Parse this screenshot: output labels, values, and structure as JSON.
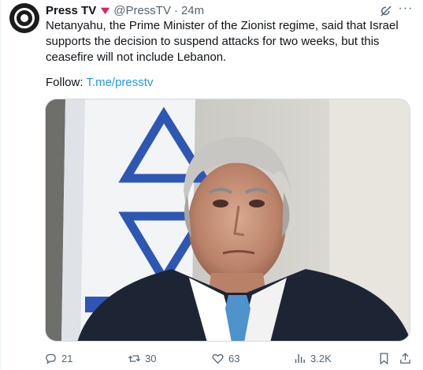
{
  "tweet": {
    "author_name": "Press TV",
    "handle": "@PressTV",
    "separator": "·",
    "time": "24m",
    "text": "Netanyahu, the Prime Minister of the Zionist regime, said that Israel supports the decision to suspend attacks for two weeks, but this ceasefire will not include Lebanon.",
    "follow_label": "Follow: ",
    "follow_link": "T.me/presstv",
    "more_label": "···"
  },
  "actions": {
    "replies": "21",
    "reposts": "30",
    "likes": "63",
    "views": "3.2K"
  },
  "icons": [
    "avatar",
    "verified-badge-icon",
    "grok-icon",
    "more-icon",
    "reply-icon",
    "repost-icon",
    "like-icon",
    "views-icon",
    "bookmark-icon",
    "share-icon"
  ],
  "colors": {
    "text": "#0f1419",
    "secondary": "#536471",
    "link": "#1d9bf0",
    "badge": "#e0245e"
  }
}
